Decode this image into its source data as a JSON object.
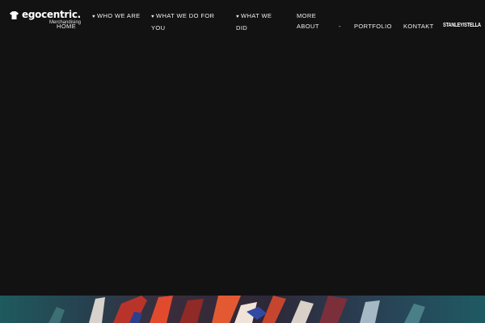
{
  "brand": {
    "name": "egocentric.",
    "tagline": "Merchandising",
    "logo_icon": "tshirt-icon"
  },
  "nav": {
    "home": "HOME",
    "who_we_are": "WHO WE ARE",
    "what_we_do_for_you": "WHAT WE DO FOR YOU",
    "what_we_did": "WHAT WE DID",
    "more_about": "MORE ABOUT",
    "separator": "-",
    "portfolio": "PORTFOLIO",
    "kontakt": "KONTAKT",
    "dropdown_marker": "♥"
  },
  "partner_logo": {
    "text": "STANLEY/STELLA"
  },
  "colors": {
    "background": "#121212",
    "text": "#f2f2f2"
  }
}
